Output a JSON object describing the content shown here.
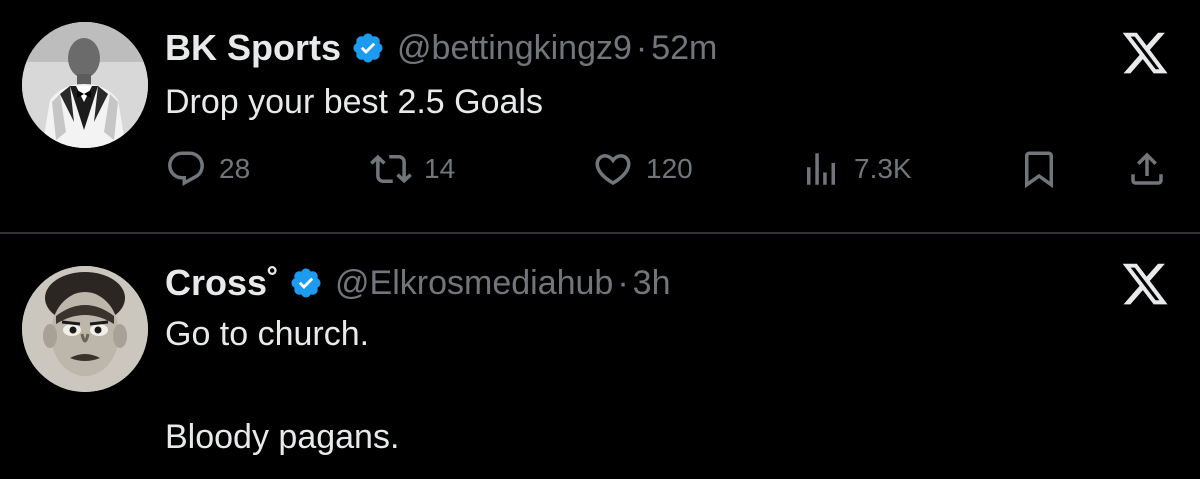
{
  "tweets": [
    {
      "display_name": "BK Sports",
      "handle": "@bettingkingz9",
      "separator": "·",
      "time": "52m",
      "text_lines": [
        "Drop your best 2.5 Goals"
      ],
      "stats": {
        "replies": "28",
        "reposts": "14",
        "likes": "120",
        "views": "7.3K"
      },
      "avatar_icon": "avatar-man-in-tuxedo"
    },
    {
      "display_name": "Cross˚",
      "handle": "@Elkrosmediahub",
      "separator": "·",
      "time": "3h",
      "text_lines": [
        "Go to church.",
        "Bloody pagans."
      ],
      "avatar_icon": "avatar-caricature-face"
    }
  ],
  "icons": {
    "verified": "verified-badge-icon",
    "close": "x-logo-icon",
    "reply": "reply-icon",
    "repost": "repost-icon",
    "like": "heart-icon",
    "views": "views-icon",
    "bookmark": "bookmark-icon",
    "share": "share-icon"
  },
  "colors": {
    "background": "#000000",
    "primary_text": "#e7e9ea",
    "secondary_text": "#71767b",
    "verified_blue": "#1d9bf0",
    "divider": "#2f3336"
  }
}
